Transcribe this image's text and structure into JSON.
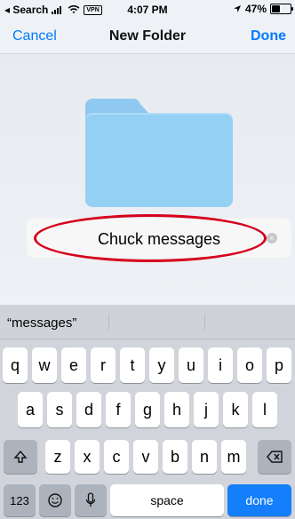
{
  "status": {
    "back_app": "◂ Search",
    "time": "4:07 PM",
    "vpn": "VPN",
    "battery": "47%",
    "battery_level": 0.47
  },
  "nav": {
    "cancel": "Cancel",
    "title": "New Folder",
    "done": "Done"
  },
  "folder_name_field": {
    "value": "Chuck messages"
  },
  "suggestions": [
    "“messages”",
    "",
    ""
  ],
  "keyboard": {
    "row1": [
      "q",
      "w",
      "e",
      "r",
      "t",
      "y",
      "u",
      "i",
      "o",
      "p"
    ],
    "row2": [
      "a",
      "s",
      "d",
      "f",
      "g",
      "h",
      "j",
      "k",
      "l"
    ],
    "row3": [
      "z",
      "x",
      "c",
      "v",
      "b",
      "n",
      "m"
    ],
    "numbers": "123",
    "space": "space",
    "done": "done"
  },
  "icons": {
    "shift": "shift-icon",
    "delete": "delete-icon",
    "emoji": "emoji-icon",
    "mic": "mic-icon",
    "clear": "clear-text-icon"
  },
  "colors": {
    "accent": "#007aff",
    "folder": "#94d0f4",
    "highlight_ellipse": "#d6001c",
    "done_key": "#147efb"
  }
}
